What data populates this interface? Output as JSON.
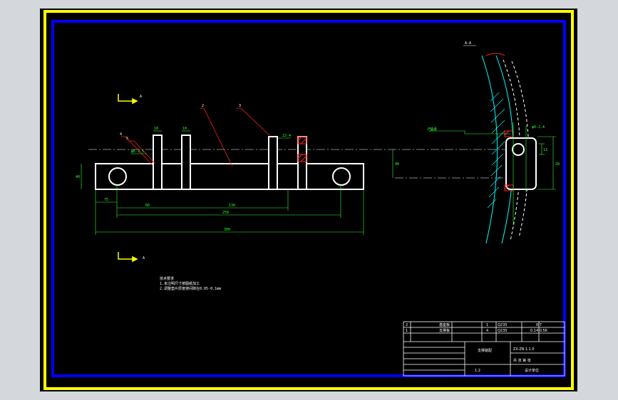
{
  "drawing": {
    "colors": {
      "frame_outer": "#ffff00",
      "frame_inner": "#0000ff",
      "part": "#ffffff",
      "dimension": "#33ff33",
      "leader": "#ff2020",
      "hatch": "#00ffff",
      "background": "#000000"
    },
    "section_marks": {
      "top": "A",
      "bottom": "A"
    },
    "view_label": "A-A",
    "part_numbers": {
      "p1": "2",
      "p2": "3",
      "p3": "4",
      "p4": "5"
    },
    "dimensions": {
      "d_height": "40",
      "d_rib1": "10",
      "d_rib2": "10",
      "d_start": "75",
      "d_60": "60",
      "d_130": "130",
      "d_250": "250",
      "d_300": "300",
      "d_fit": "22-4",
      "d_chamfer": "φ6-2.5",
      "d_gap": "40",
      "d_right_a": "φ6-2.4",
      "d_right_b": "13",
      "d_right_c": "28"
    },
    "side_view_label": "P轴承",
    "tech_notes": {
      "title": "技术要求",
      "line1": "1.未注明尺寸按图纸加工",
      "line2": "2.调整垫片厚度使间隙在0.05-0.1mm"
    },
    "bom": [
      {
        "no": "2",
        "name": "基座板",
        "qty": "1",
        "material": "Q235",
        "weight": "0.7"
      },
      {
        "no": "1",
        "name": "支撑板",
        "qty": "4",
        "material": "Q235",
        "weight": "0.14  0.56"
      }
    ],
    "title_block": {
      "part_name": "支撑装配",
      "scale": "1:2",
      "drawing_no": "ZX-ZB.1.1.0",
      "sheet": "共 张 第 张",
      "company": "设计单位"
    }
  }
}
